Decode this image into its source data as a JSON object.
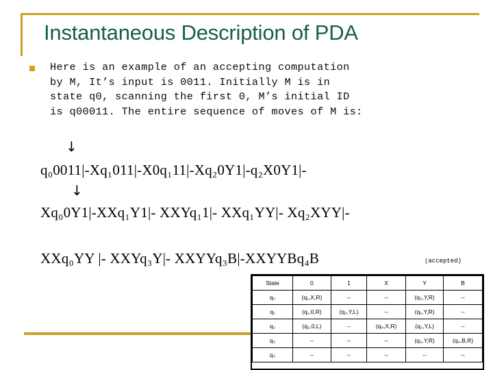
{
  "slide": {
    "title": "Instantaneous Description of PDA",
    "accent_gold": "#c9a227",
    "title_green": "#176141",
    "bullet_color": "#d4a017",
    "body_paragraph": "Here is an example of an accepting computation\nby M, It’s input is 0011. Initially M is in\nstate q0, scanning the first 0, M’s initial ID\nis q00011. The entire sequence of moves of M is:"
  },
  "arrows": {
    "first": "↓",
    "second": "↓"
  },
  "derivation": {
    "line1": "q₀0011|-Xq₁011|-X0q₁11|-Xq₂0Y1|-q₂X0Y1|-",
    "line2": "Xq₀0Y1|-XXq₁Y1|- XXYq₁1|- XXq₁YY|- Xq₂XYY|-",
    "line3": "XXq₀YY |- XXYq₃Y|- XXYYq₃B|-XXYYBq₄B",
    "accepted_note": "(accepted)"
  },
  "transition_table": {
    "headers": [
      "State",
      "0",
      "1",
      "X",
      "Y",
      "B"
    ],
    "rows": [
      {
        "state": "q₀",
        "cells": [
          "(q₁,X,R)",
          "--",
          "--",
          "(q₃,Y,R)",
          "--"
        ]
      },
      {
        "state": "q₁",
        "cells": [
          "(q₁,0,R)",
          "(q₂,Y,L)",
          "--",
          "(q₁,Y,R)",
          "--"
        ]
      },
      {
        "state": "q₂",
        "cells": [
          "(q₂,0,L)",
          "--",
          "(q₀,X,R)",
          "(q₂,Y,L)",
          "--"
        ]
      },
      {
        "state": "q₃",
        "cells": [
          "--",
          "--",
          "--",
          "(q₃,Y,R)",
          "(q₄,B,R)"
        ]
      },
      {
        "state": "q₄",
        "cells": [
          "--",
          "--",
          "--",
          "--",
          "--"
        ]
      }
    ]
  }
}
